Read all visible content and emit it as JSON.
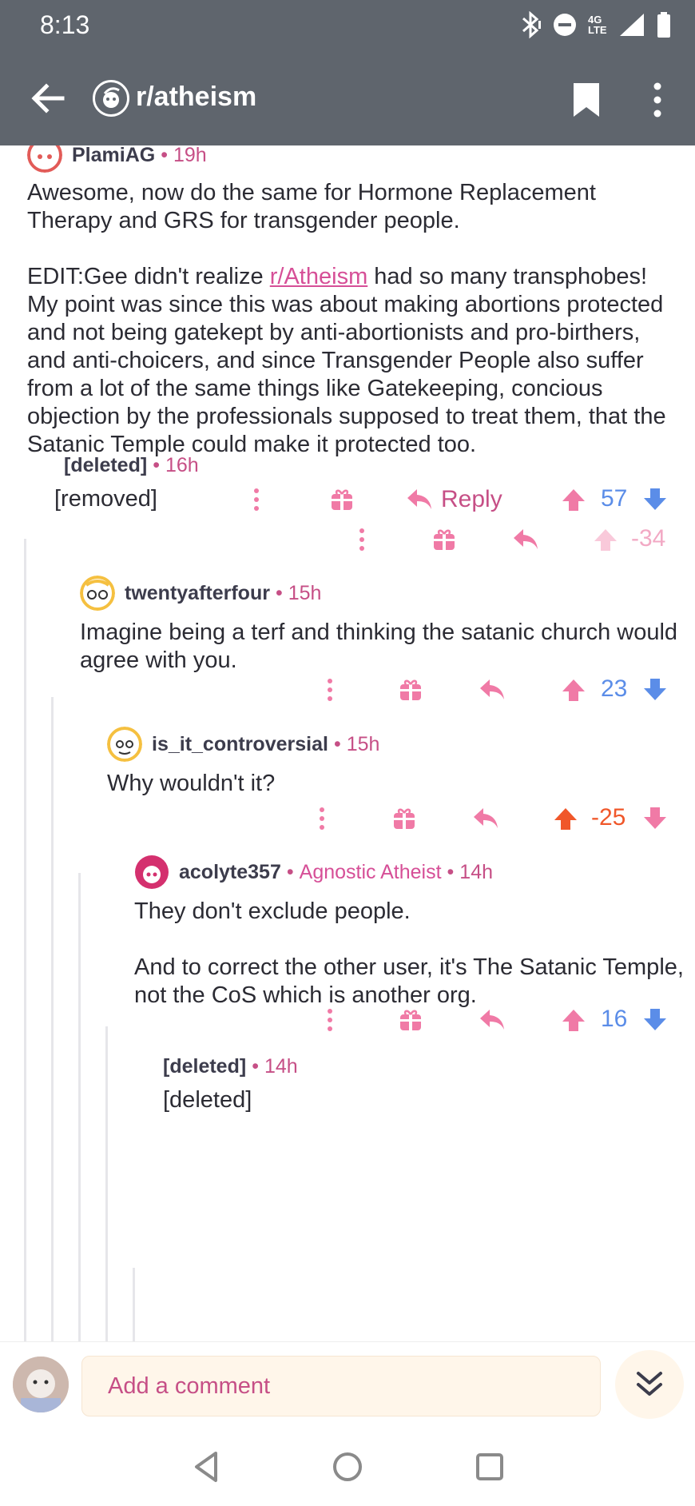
{
  "status_bar": {
    "time": "8:13",
    "network": "4G LTE",
    "icons": [
      "bluetooth-icon",
      "do-not-disturb-icon",
      "signal-icon",
      "battery-icon"
    ]
  },
  "header": {
    "subreddit": "r/atheism",
    "icons": [
      "back-arrow-icon",
      "subreddit-icon",
      "bookmark-icon",
      "more-vertical-icon"
    ]
  },
  "colors": {
    "header_bg": "#5f656d",
    "accent_pink": "#c64f86",
    "upvote_pink": "#f07aa6",
    "blue": "#5b8de8",
    "orange": "#f0572a"
  },
  "comments": [
    {
      "author": "PlamiAG",
      "time": "19h",
      "body": [
        "Awesome, now do the same for Hormone Replacement Therapy and GRS for transgender people."
      ],
      "edit_before": "EDIT:Gee didn't realize ",
      "edit_link": "r/Atheism",
      "edit_after": " had so many transphobes! My point was since this was about making abortions protected and not being gatekept by anti-abortionists and pro-birthers, and anti-choicers, and since Transgender People also suffer from a lot of the same things like Gatekeeping, concious objection by the professionals supposed to treat them, that the Satanic Temple could make it protected too.",
      "reply_label": "Reply",
      "score": "57"
    },
    {
      "author": "[deleted]",
      "time": "16h",
      "body": [
        "[removed]"
      ],
      "score": "-34"
    },
    {
      "author": "twentyafterfour",
      "time": "15h",
      "body": [
        "Imagine being a terf and thinking the satanic church would agree with you."
      ],
      "score": "23"
    },
    {
      "author": "is_it_controversial",
      "time": "15h",
      "body": [
        "Why wouldn't it?"
      ],
      "score": "-25"
    },
    {
      "author": "acolyte357",
      "flair": "Agnostic Atheist",
      "time": "14h",
      "body": [
        "They don't exclude people.",
        "And to correct the other user, it's The Satanic Temple, not the CoS which is another org."
      ],
      "score": "16"
    },
    {
      "author": "[deleted]",
      "time": "14h",
      "body": [
        "[deleted]"
      ]
    }
  ],
  "composer": {
    "placeholder": "Add a comment"
  },
  "nav": {
    "icons": [
      "back-triangle-icon",
      "home-circle-icon",
      "recents-square-icon"
    ]
  }
}
